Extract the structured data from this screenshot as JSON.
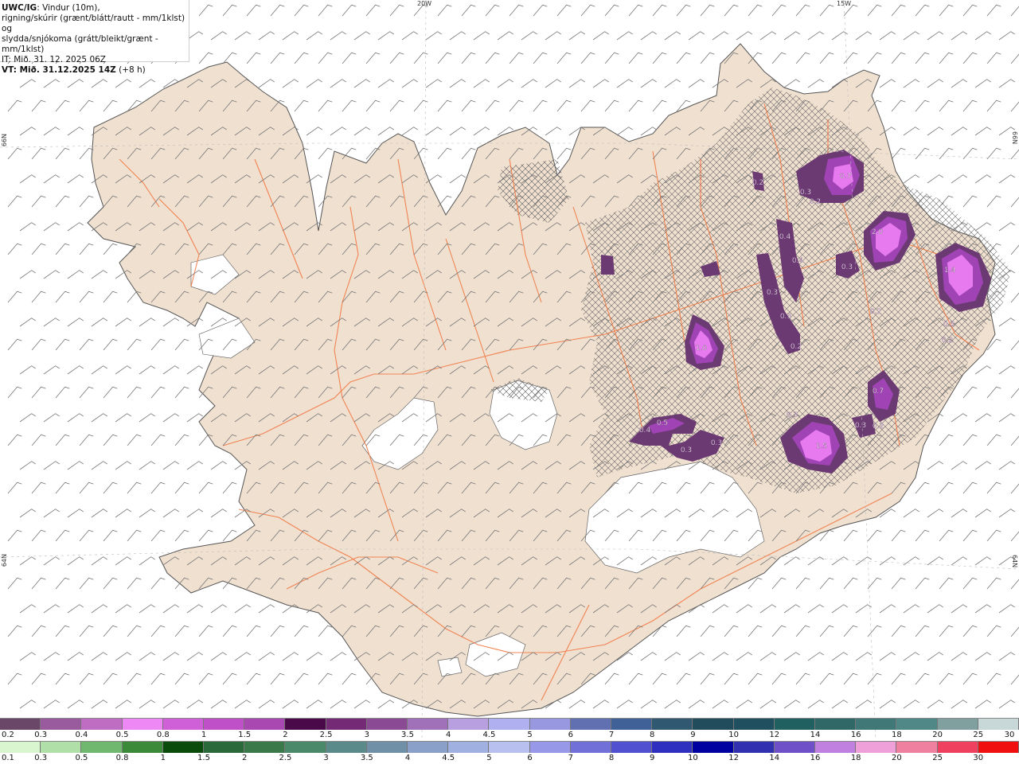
{
  "header": {
    "model_label": "UWC/IG",
    "title_line1_rest": ": Vindur (10m),",
    "title_line2": "rigning/skúrir (grænt/blátt/rautt - mm/1klst) og",
    "title_line3": "slydda/snjókoma (grátt/bleikt/grænt - mm/1klst)",
    "it_line": "IT: Mið. 31. 12. 2025 06Z",
    "vt_label": "VT: Mið. 31.12.2025 14Z",
    "vt_offset": " (+8 h)"
  },
  "graticule": {
    "top_left_lon": "20W",
    "top_right_lon": "15W",
    "left_lat_upper": "66N",
    "left_lat_lower": "64N",
    "right_lat_upper": "66N",
    "right_lat_lower": "64N"
  },
  "precip_labels": [
    {
      "text": "0.2"
    },
    {
      "text": "0.3"
    },
    {
      "text": "0.2"
    },
    {
      "text": "0.7"
    },
    {
      "text": "2.0"
    },
    {
      "text": "0.4"
    },
    {
      "text": "0.4"
    },
    {
      "text": "0.3"
    },
    {
      "text": "1.4"
    },
    {
      "text": "0.3"
    },
    {
      "text": "0.2"
    },
    {
      "text": "0.3"
    },
    {
      "text": "0.3"
    },
    {
      "text": "0.2"
    },
    {
      "text": "1.0"
    },
    {
      "text": "0.2"
    },
    {
      "text": "0.7"
    },
    {
      "text": "0.2"
    },
    {
      "text": "0.3"
    },
    {
      "text": "0.3"
    },
    {
      "text": "0.5"
    },
    {
      "text": "0.4"
    },
    {
      "text": "0.3"
    },
    {
      "text": "0.3"
    },
    {
      "text": "1.5"
    }
  ],
  "colors": {
    "land": "#f0e0d0",
    "roads": "#f27a45",
    "glacier": "#ffffff",
    "coast": "#555555",
    "snow_dark": "#6b3a72",
    "snow_mid": "#a044b5",
    "snow_bright": "#e87af0"
  },
  "snow_scale": {
    "ticks": [
      "0.2",
      "0.3",
      "0.4",
      "0.5",
      "0.8",
      "1",
      "1.5",
      "2",
      "2.5",
      "3",
      "3.5",
      "4",
      "4.5",
      "5",
      "6",
      "7",
      "8",
      "9",
      "10",
      "12",
      "14",
      "16",
      "18",
      "20",
      "25",
      "30"
    ],
    "colors": [
      "#6a4668",
      "#9a5b9e",
      "#bf6cc3",
      "#ee88f5",
      "#d060d8",
      "#c050c8",
      "#a848b0",
      "#4a0a4a",
      "#742a74",
      "#8a4a94",
      "#a070b8",
      "#b8a0e0",
      "#b0b0f0",
      "#9898e0",
      "#6070b0",
      "#406098",
      "#305870",
      "#204c5c",
      "#205060",
      "#206060",
      "#306868",
      "#407878",
      "#508888",
      "#80a0a0",
      "#c8d8d8"
    ]
  },
  "rain_scale": {
    "ticks": [
      "0.1",
      "0.3",
      "0.5",
      "0.8",
      "1",
      "1.5",
      "2",
      "2.5",
      "3",
      "3.5",
      "4",
      "4.5",
      "5",
      "6",
      "7",
      "8",
      "9",
      "10",
      "12",
      "14",
      "16",
      "18",
      "20",
      "25",
      "30"
    ],
    "colors": [
      "#d8f5d0",
      "#b0e0a8",
      "#70b870",
      "#3a8a3a",
      "#0a4a0a",
      "#2a6a3a",
      "#3a7a4a",
      "#4a8a6a",
      "#5a8a8a",
      "#7090a8",
      "#8aa0c8",
      "#a0b0e0",
      "#b8c0f0",
      "#9898e8",
      "#7070d8",
      "#5050d0",
      "#3030c0",
      "#0000a0",
      "#3030b0",
      "#7050c8",
      "#c080e0",
      "#f0a0d8",
      "#f080a0",
      "#f04060",
      "#f01010"
    ]
  }
}
